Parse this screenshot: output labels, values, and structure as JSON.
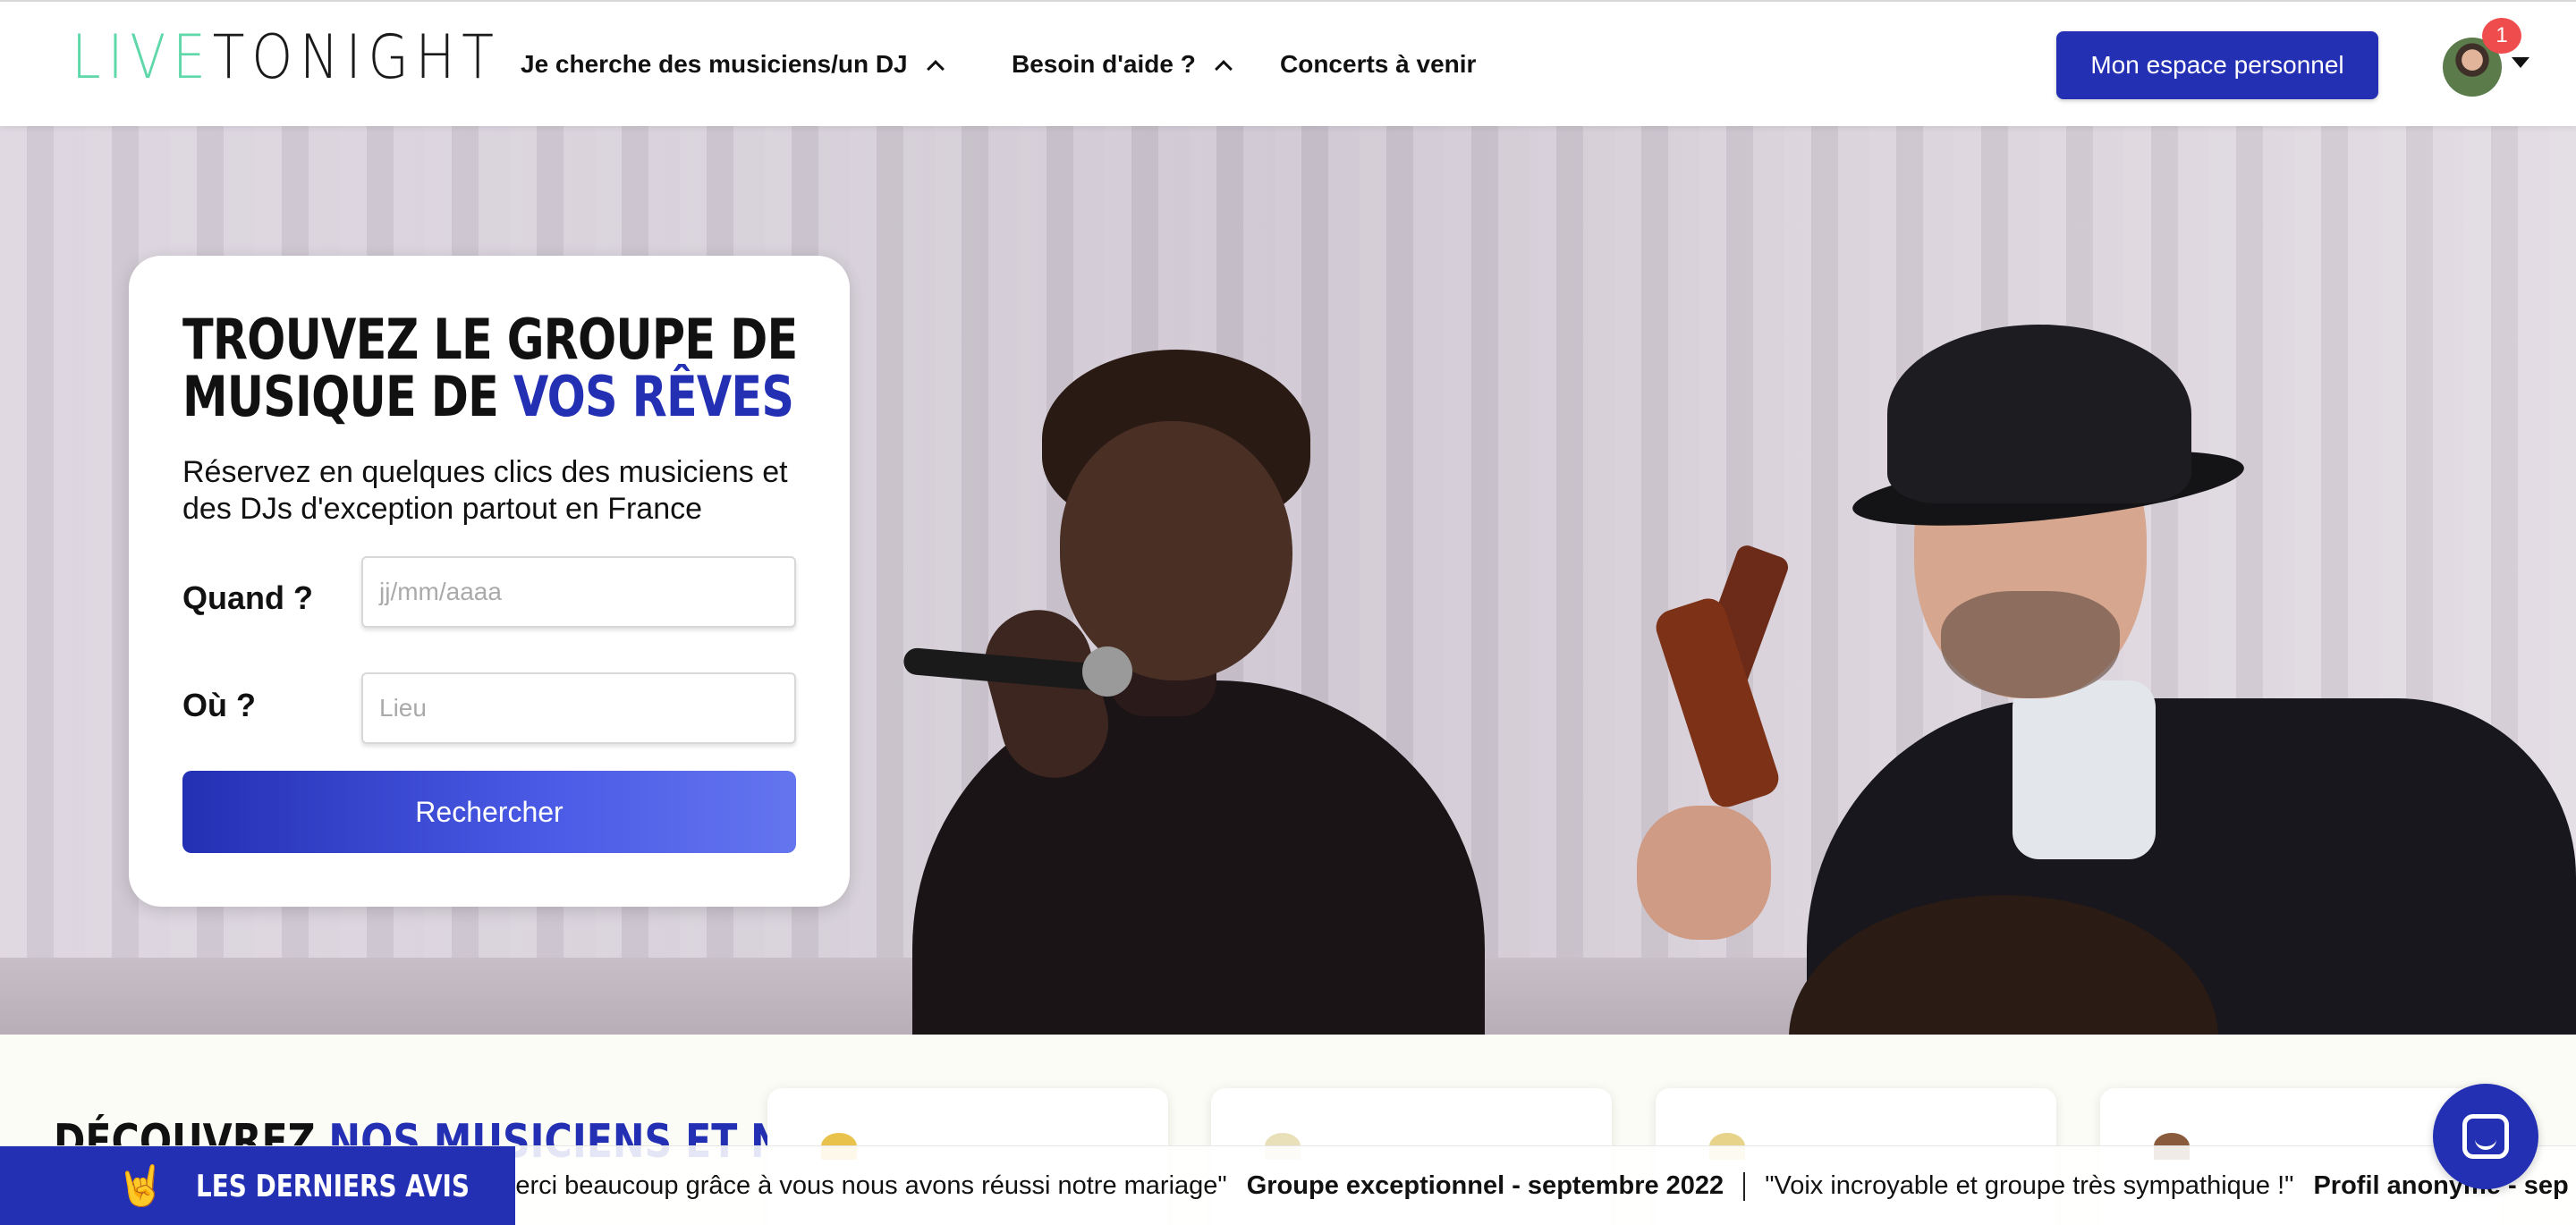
{
  "brand": {
    "logo_part1": "LIVE",
    "logo_part2": "TONIGHT",
    "accent": "#2330b4",
    "logo_accent": "#5ed8a8"
  },
  "nav": {
    "item1": "Je cherche des musiciens/un DJ",
    "item2": "Besoin d'aide ?",
    "item3": "Concerts à venir",
    "cta": "Mon espace personnel",
    "notification_count": "1"
  },
  "search_card": {
    "title_line1": "Trouvez le groupe de",
    "title_line2_prefix": "musique de ",
    "title_line2_highlight": "vos rêves",
    "subtitle": "Réservez en quelques clics des musiciens et des DJs d'exception partout en France",
    "when_label": "Quand ?",
    "when_placeholder": "jj/mm/aaaa",
    "where_label": "Où ?",
    "where_placeholder": "Lieu",
    "button": "Rechercher"
  },
  "discover": {
    "prefix": "Découvrez ",
    "highlight": "nos musiciens et nos"
  },
  "reviews": {
    "label": "Les derniers avis",
    "emoji": "🤘",
    "items": [
      {
        "quote": "e Merci beaucoup grâce à vous nous avons réussi notre mariage\"",
        "author": "Groupe exceptionnel - septembre 2022"
      },
      {
        "quote": "\"Voix incroyable et groupe très sympathique !\"",
        "author": "Profil anonyme - sep"
      }
    ]
  }
}
